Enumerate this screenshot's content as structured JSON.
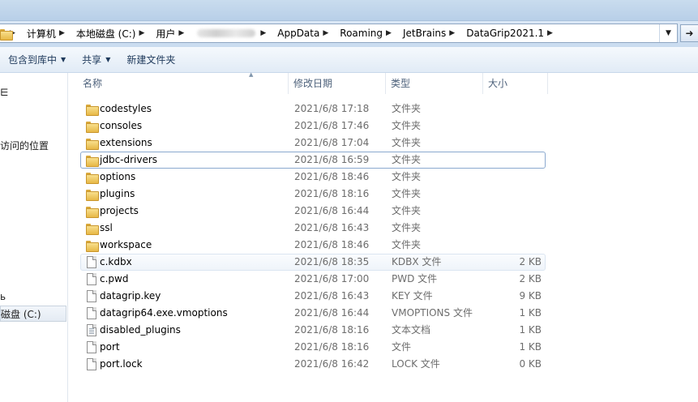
{
  "address": {
    "crumbs": [
      "计算机",
      "本地磁盘 (C:)",
      "用户",
      "AppData",
      "Roaming",
      "JetBrains",
      "DataGrip2021.1"
    ]
  },
  "toolbar": {
    "include_library": "包含到库中",
    "share": "共享",
    "new_folder": "新建文件夹"
  },
  "nav": {
    "items": [
      "⋿",
      "访问的位置",
      "ь",
      "磁盘 (C:)"
    ]
  },
  "columns": {
    "name": "名称",
    "date": "修改日期",
    "type": "类型",
    "size": "大小"
  },
  "files": [
    {
      "name": "codestyles",
      "date": "2021/6/8 17:18",
      "type": "文件夹",
      "size": "",
      "icon": "folder-icon"
    },
    {
      "name": "consoles",
      "date": "2021/6/8 17:46",
      "type": "文件夹",
      "size": "",
      "icon": "folder-icon"
    },
    {
      "name": "extensions",
      "date": "2021/6/8 17:04",
      "type": "文件夹",
      "size": "",
      "icon": "folder-icon"
    },
    {
      "name": "jdbc-drivers",
      "date": "2021/6/8 16:59",
      "type": "文件夹",
      "size": "",
      "icon": "folder-icon"
    },
    {
      "name": "options",
      "date": "2021/6/8 18:46",
      "type": "文件夹",
      "size": "",
      "icon": "folder-icon"
    },
    {
      "name": "plugins",
      "date": "2021/6/8 18:16",
      "type": "文件夹",
      "size": "",
      "icon": "folder-icon"
    },
    {
      "name": "projects",
      "date": "2021/6/8 16:44",
      "type": "文件夹",
      "size": "",
      "icon": "folder-icon"
    },
    {
      "name": "ssl",
      "date": "2021/6/8 16:43",
      "type": "文件夹",
      "size": "",
      "icon": "folder-icon"
    },
    {
      "name": "workspace",
      "date": "2021/6/8 18:46",
      "type": "文件夹",
      "size": "",
      "icon": "folder-icon"
    },
    {
      "name": "c.kdbx",
      "date": "2021/6/8 18:35",
      "type": "KDBX 文件",
      "size": "2 KB",
      "icon": "file-icon"
    },
    {
      "name": "c.pwd",
      "date": "2021/6/8 17:00",
      "type": "PWD 文件",
      "size": "2 KB",
      "icon": "file-icon"
    },
    {
      "name": "datagrip.key",
      "date": "2021/6/8 16:43",
      "type": "KEY 文件",
      "size": "9 KB",
      "icon": "file-icon"
    },
    {
      "name": "datagrip64.exe.vmoptions",
      "date": "2021/6/8 16:44",
      "type": "VMOPTIONS 文件",
      "size": "1 KB",
      "icon": "file-icon"
    },
    {
      "name": "disabled_plugins",
      "date": "2021/6/8 18:16",
      "type": "文本文档",
      "size": "1 KB",
      "icon": "text-file-icon"
    },
    {
      "name": "port",
      "date": "2021/6/8 18:16",
      "type": "文件",
      "size": "1 KB",
      "icon": "file-icon"
    },
    {
      "name": "port.lock",
      "date": "2021/6/8 16:42",
      "type": "LOCK 文件",
      "size": "0 KB",
      "icon": "file-icon"
    }
  ]
}
